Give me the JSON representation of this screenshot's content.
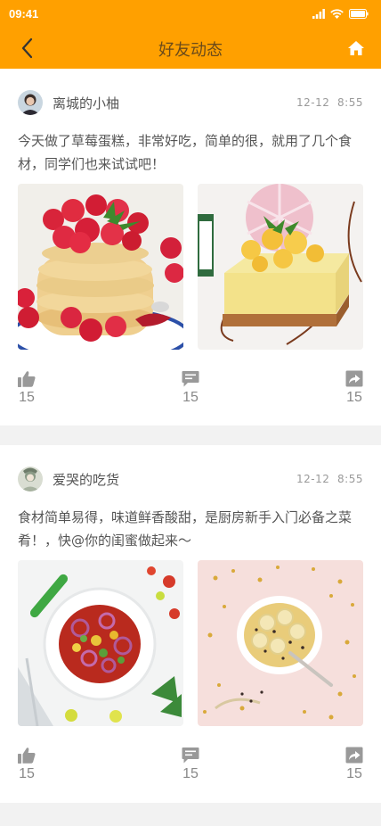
{
  "status": {
    "time": "09:41"
  },
  "nav": {
    "title": "好友动态"
  },
  "colors": {
    "brand": "#ffa000",
    "text": "#555555",
    "muted": "#9a9a9a"
  },
  "posts": [
    {
      "user": "离城的小柚",
      "date": "12-12",
      "time": "8:55",
      "text": "今天做了草莓蛋糕，非常好吃，简单的很，就用了几个食材，同学们也来试试吧！",
      "images": [
        "raspberry-pancakes",
        "mango-cheesecake"
      ],
      "likes": "15",
      "comments": "15",
      "shares": "15"
    },
    {
      "user": "爱哭的吃货",
      "date": "12-12",
      "time": "8:55",
      "text": "食材简单易得，味道鲜香酸甜，是厨房新手入门必备之菜肴！，快@你的闺蜜做起来～",
      "images": [
        "tomato-onion-salad",
        "banana-oatmeal-bowl"
      ],
      "likes": "15",
      "comments": "15",
      "shares": "15"
    }
  ]
}
